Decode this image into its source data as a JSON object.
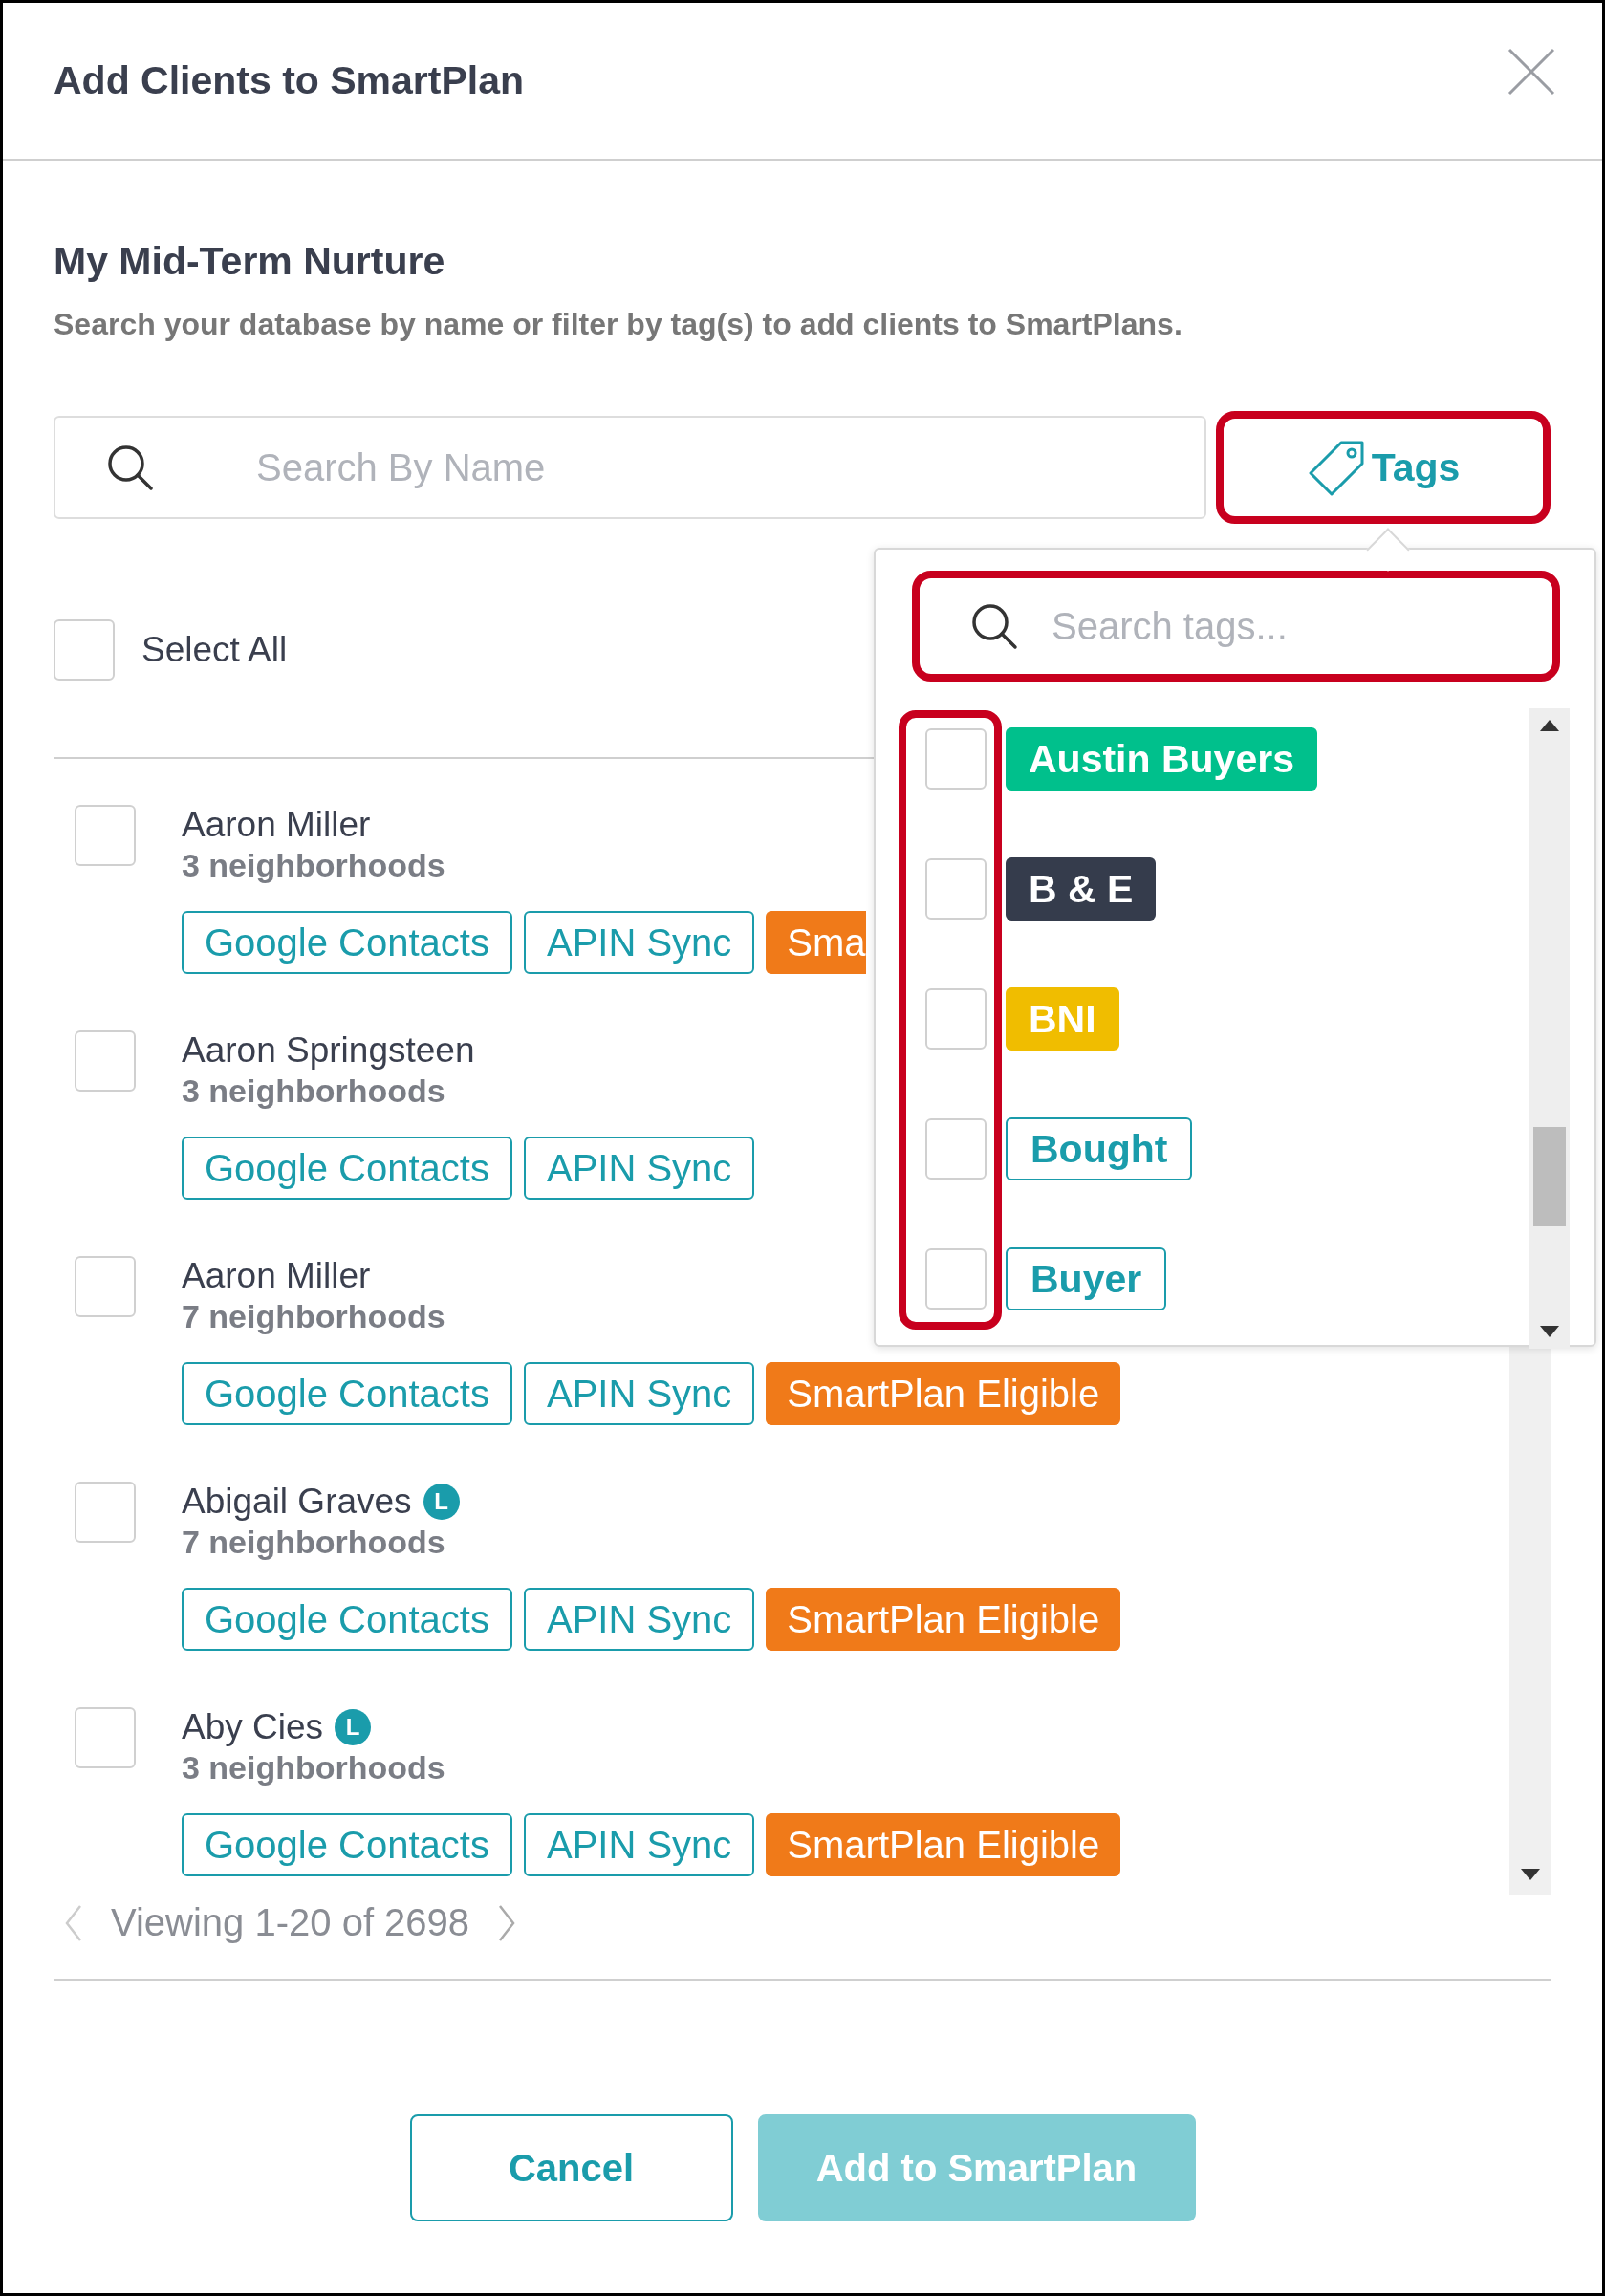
{
  "modal": {
    "title": "Add Clients to SmartPlan"
  },
  "plan": {
    "title": "My Mid-Term Nurture",
    "description": "Search your database by name or filter by tag(s) to add clients to SmartPlans."
  },
  "search": {
    "placeholder": "Search By Name"
  },
  "tags_button": {
    "label": "Tags",
    "highlighted": true
  },
  "select_all": {
    "label": "Select All",
    "checked": false
  },
  "clients": [
    {
      "name": "Aaron Miller",
      "neighborhoods": "3 neighborhoods",
      "checked": false,
      "tags": [
        {
          "label": "Google Contacts",
          "kind": "outline",
          "color": "#1a9cab"
        },
        {
          "label": "APIN Sync",
          "kind": "outline",
          "color": "#1a9cab"
        },
        {
          "label": "Sma",
          "kind": "cut",
          "color": "#f07a19"
        }
      ]
    },
    {
      "name": "Aaron Springsteen",
      "neighborhoods": "3 neighborhoods",
      "checked": false,
      "tags": [
        {
          "label": "Google Contacts",
          "kind": "outline",
          "color": "#1a9cab"
        },
        {
          "label": "APIN Sync",
          "kind": "outline",
          "color": "#1a9cab"
        }
      ]
    },
    {
      "name": "Aaron Miller",
      "neighborhoods": "7 neighborhoods",
      "checked": false,
      "tags": [
        {
          "label": "Google Contacts",
          "kind": "outline",
          "color": "#1a9cab"
        },
        {
          "label": "APIN Sync",
          "kind": "outline",
          "color": "#1a9cab"
        },
        {
          "label": "SmartPlan Eligible",
          "kind": "filled",
          "color": "#f07a19"
        }
      ]
    },
    {
      "name": "Abigail Graves",
      "badge": "L",
      "neighborhoods": "7 neighborhoods",
      "checked": false,
      "tags": [
        {
          "label": "Google Contacts",
          "kind": "outline",
          "color": "#1a9cab"
        },
        {
          "label": "APIN Sync",
          "kind": "outline",
          "color": "#1a9cab"
        },
        {
          "label": "SmartPlan Eligible",
          "kind": "filled",
          "color": "#f07a19"
        }
      ]
    },
    {
      "name": "Aby Cies",
      "badge": "L",
      "neighborhoods": "3 neighborhoods",
      "checked": false,
      "tags": [
        {
          "label": "Google Contacts",
          "kind": "outline",
          "color": "#1a9cab"
        },
        {
          "label": "APIN Sync",
          "kind": "outline",
          "color": "#1a9cab"
        },
        {
          "label": "SmartPlan Eligible",
          "kind": "filled",
          "color": "#f07a19"
        }
      ]
    }
  ],
  "tag_dropdown": {
    "search": {
      "placeholder": "Search tags...",
      "highlighted": true
    },
    "checkboxes_highlighted": true,
    "tags": [
      {
        "label": "Austin Buyers",
        "kind": "filled",
        "color": "#00c08c",
        "checked": false
      },
      {
        "label": "B & E",
        "kind": "filled",
        "color": "#353c4c",
        "checked": false
      },
      {
        "label": "BNI",
        "kind": "filled",
        "color": "#f0bd00",
        "checked": false
      },
      {
        "label": "Bought",
        "kind": "outline",
        "color": "#1a9cab",
        "checked": false
      },
      {
        "label": "Buyer",
        "kind": "outline",
        "color": "#1a9cab",
        "checked": false
      }
    ]
  },
  "pagination": {
    "text": "Viewing 1-20 of 2698"
  },
  "buttons": [
    {
      "label": "Cancel",
      "kind": "secondary",
      "disabled": false
    },
    {
      "label": "Add to SmartPlan",
      "kind": "primary",
      "disabled": true
    }
  ]
}
